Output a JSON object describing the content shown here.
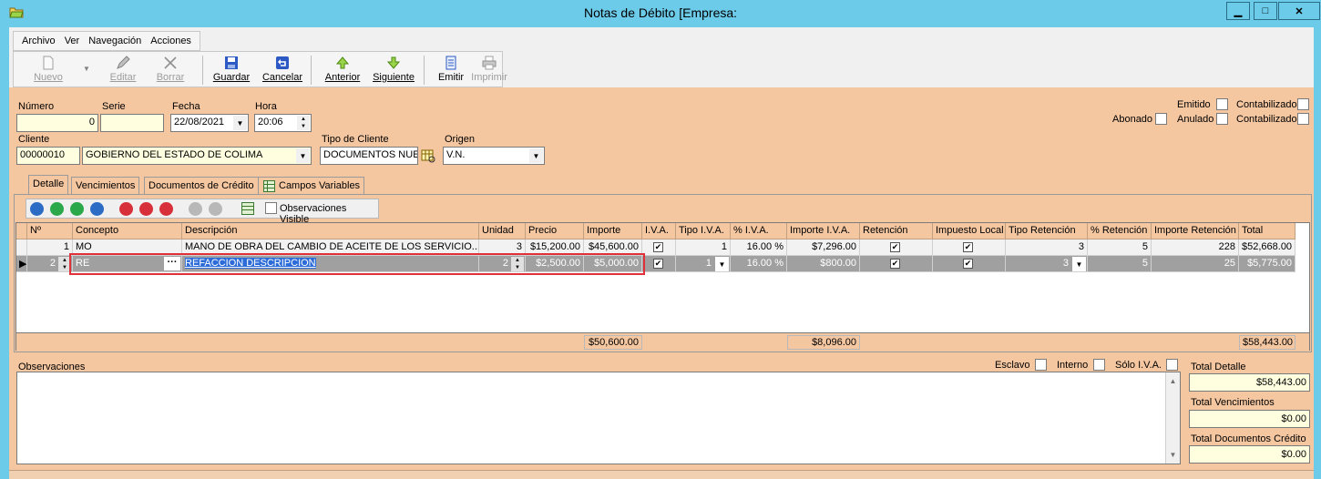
{
  "window": {
    "title": "Notas de Débito [Empresa:",
    "min_label": "▁",
    "max_label": "□",
    "close_label": "✕"
  },
  "menu": [
    "Archivo",
    "Ver",
    "Navegación",
    "Acciones"
  ],
  "toolbar": {
    "nuevo": "Nuevo",
    "editar": "Editar",
    "borrar": "Borrar",
    "guardar": "Guardar",
    "cancelar": "Cancelar",
    "anterior": "Anterior",
    "siguiente": "Siguiente",
    "emitir": "Emitir",
    "imprimir": "Imprimir"
  },
  "form": {
    "numero_label": "Número",
    "numero": "0",
    "serie_label": "Serie",
    "serie": "",
    "fecha_label": "Fecha",
    "fecha": "22/08/2021",
    "hora_label": "Hora",
    "hora": "20:06",
    "cliente_label": "Cliente",
    "cliente_codigo": "00000010",
    "cliente_nombre": "GOBIERNO DEL ESTADO DE COLIMA",
    "tipo_cliente_label": "Tipo de Cliente",
    "tipo_cliente": "DOCUMENTOS NUEVO",
    "origen_label": "Origen",
    "origen": "V.N.",
    "emitido_label": "Emitido",
    "contabilizado1_label": "Contabilizado",
    "abonado_label": "Abonado",
    "anulado_label": "Anulado",
    "contabilizado2_label": "Contabilizado"
  },
  "tabs": [
    "Detalle",
    "Vencimientos",
    "Documentos de Crédito",
    "Campos Variables"
  ],
  "grid_toolbar": {
    "observaciones_visible": "Observaciones Visible"
  },
  "grid": {
    "headers": [
      "Nº",
      "Concepto",
      "Descripción",
      "Unidad",
      "Precio",
      "Importe",
      "I.V.A.",
      "Tipo I.V.A.",
      "% I.V.A.",
      "Importe I.V.A.",
      "Retención",
      "Impuesto Local",
      "Tipo Retención",
      "% Retención",
      "Importe Retención",
      "Total"
    ],
    "rows": [
      {
        "n": "1",
        "concepto": "MO",
        "descripcion": "MANO DE OBRA DEL CAMBIO DE ACEITE DE LOS SERVICIO...",
        "unidad": "3",
        "precio": "$15,200.00",
        "importe": "$45,600.00",
        "tipo_iva": "1",
        "pct_iva": "16.00 %",
        "importe_iva": "$7,296.00",
        "tipo_ret": "3",
        "pct_ret": "5",
        "importe_ret": "228",
        "total": "$52,668.00"
      },
      {
        "n": "2",
        "concepto": "RE",
        "descripcion": "REFACCION DESCRIPCION",
        "unidad": "2",
        "precio": "$2,500.00",
        "importe": "$5,000.00",
        "tipo_iva": "1",
        "pct_iva": "16.00 %",
        "importe_iva": "$800.00",
        "tipo_ret": "3",
        "pct_ret": "5",
        "importe_ret": "25",
        "total": "$5,775.00"
      }
    ],
    "totals": {
      "importe": "$50,600.00",
      "importe_iva": "$8,096.00",
      "total": "$58,443.00"
    }
  },
  "observaciones": {
    "label": "Observaciones",
    "esclavo_label": "Esclavo",
    "interno_label": "Interno",
    "solo_iva_label": "Sólo I.V.A."
  },
  "totales": {
    "detalle_label": "Total Detalle",
    "detalle": "$58,443.00",
    "vencimientos_label": "Total Vencimientos",
    "vencimientos": "$0.00",
    "documentos_label": "Total Documentos Crédito",
    "documentos": "$0.00"
  }
}
